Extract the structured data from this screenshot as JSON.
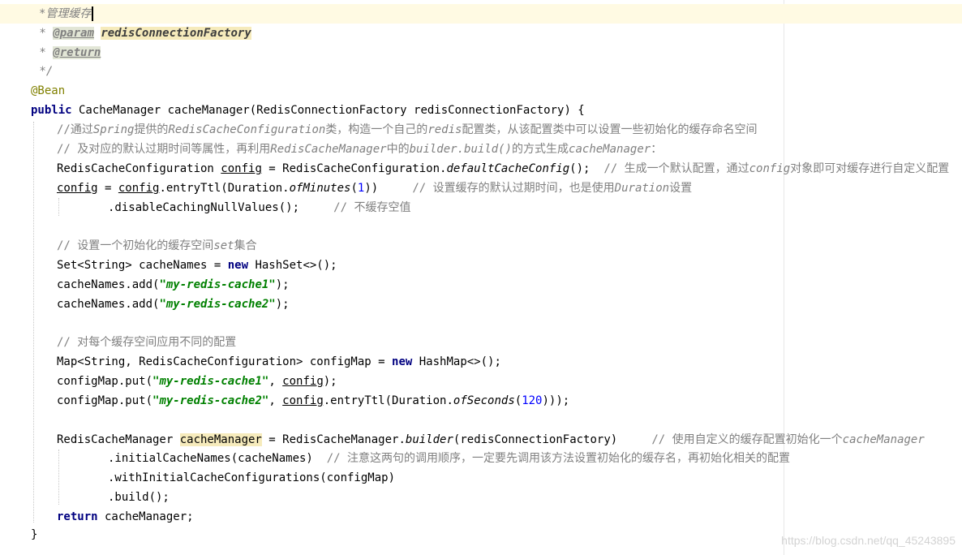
{
  "doc": {
    "l1": "*管理缓存",
    "l2_star": " * ",
    "l2_tag": "@param",
    "l2_sp": " ",
    "l2_name": "redisConnectionFactory",
    "l3_star": " * ",
    "l3_tag": "@return",
    "l4": " */"
  },
  "code": {
    "ann": "@Bean",
    "kw_public": "public",
    "sig": " CacheManager cacheManager(RedisConnectionFactory redisConnectionFactory) {",
    "c1a": "//通过",
    "c1b": "Spring",
    "c1c": "提供的",
    "c1d": "RedisCacheConfiguration",
    "c1e": "类，构造一个自己的",
    "c1f": "redis",
    "c1g": "配置类，从该配置类中可以设置一些初始化的缓存命名空间",
    "c2a": "// 及对应的默认过期时间等属性，再利用",
    "c2b": "RedisCacheManager",
    "c2c": "中的",
    "c2d": "builder.build()",
    "c2e": "的方式生成",
    "c2f": "cacheManager",
    "c2g": "：",
    "l3a": "RedisCacheConfiguration ",
    "l3b": "config",
    "l3c": " = RedisCacheConfiguration.",
    "l3d": "defaultCacheConfig",
    "l3e": "();  ",
    "l3f": "// 生成一个默认配置，通过",
    "l3g": "config",
    "l3h": "对象即可对缓存进行自定义配置",
    "l4a": "config",
    "l4b": " = ",
    "l4c": "config",
    "l4d": ".entryTtl(Duration.",
    "l4e": "ofMinutes",
    "l4f": "(",
    "l4g": "1",
    "l4h": "))     ",
    "l4i": "// 设置缓存的默认过期时间，也是使用",
    "l4j": "Duration",
    "l4k": "设置",
    "l5a": ".disableCachingNullValues();     ",
    "l5b": "// 不缓存空值",
    "c3a": "// 设置一个初始化的缓存空间",
    "c3b": "set",
    "c3c": "集合",
    "l6a": "Set<String> cacheNames = ",
    "l6b": "new",
    "l6c": " HashSet<>();",
    "l7a": "cacheNames.add(",
    "l7b": "\"my-redis-cache1\"",
    "l7c": ");",
    "l8a": "cacheNames.add(",
    "l8b": "\"my-redis-cache2\"",
    "l8c": ");",
    "c4": "// 对每个缓存空间应用不同的配置",
    "l9a": "Map<String, RedisCacheConfiguration> configMap = ",
    "l9b": "new",
    "l9c": " HashMap<>();",
    "l10a": "configMap.put(",
    "l10b": "\"my-redis-cache1\"",
    "l10c": ", ",
    "l10d": "config",
    "l10e": ");",
    "l11a": "configMap.put(",
    "l11b": "\"my-redis-cache2\"",
    "l11c": ", ",
    "l11d": "config",
    "l11e": ".entryTtl(Duration.",
    "l11f": "ofSeconds",
    "l11g": "(",
    "l11h": "120",
    "l11i": ")));",
    "l12a": "RedisCacheManager ",
    "l12b": "cacheManager",
    "l12c": " = RedisCacheManager.",
    "l12d": "builder",
    "l12e": "(redisConnectionFactory)     ",
    "l12f": "// 使用自定义的缓存配置初始化一个",
    "l12g": "cacheManager",
    "l13a": ".initialCacheNames(cacheNames)  ",
    "l13b": "// 注意这两句的调用顺序，一定要先调用该方法设置初始化的缓存名，再初始化相关的配置",
    "l14": ".withInitialCacheConfigurations(configMap)",
    "l15": ".build();",
    "kw_return": "return",
    "l16": " cacheManager;",
    "close": "}"
  },
  "watermark": "https://blog.csdn.net/qq_45243895"
}
